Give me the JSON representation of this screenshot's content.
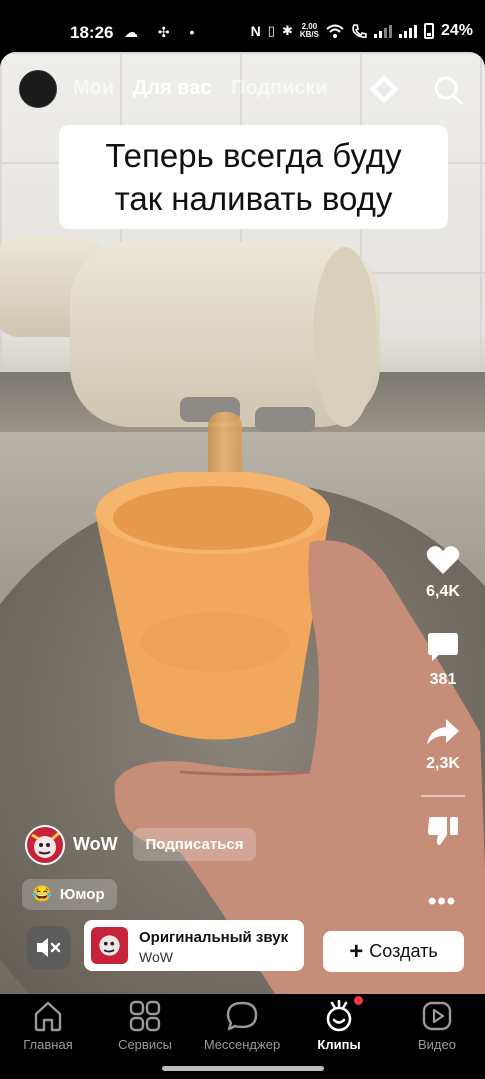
{
  "status_bar": {
    "time": "18:26",
    "speed_value": "2,00",
    "speed_unit": "KB/S",
    "battery": "24%",
    "left_icons": "☁ ✣ •"
  },
  "top_nav": {
    "tabs": [
      {
        "label": "Мои",
        "active": false
      },
      {
        "label": "Для вас",
        "active": true
      },
      {
        "label": "Подписки",
        "active": false
      }
    ]
  },
  "video": {
    "caption_line1": "Теперь всегда буду",
    "caption_line2": "так наливать воду"
  },
  "actions": {
    "likes": "6,4K",
    "comments": "381",
    "shares": "2,3K",
    "more": "•••"
  },
  "author": {
    "name": "WoW",
    "subscribe_label": "Подписаться"
  },
  "tag": {
    "emoji": "😂",
    "label": "Юмор"
  },
  "sound": {
    "title": "Оригинальный звук",
    "author": "WoW"
  },
  "create": {
    "plus": "+",
    "label": "Создать"
  },
  "bottom_nav": {
    "items": [
      {
        "label": "Главная",
        "icon": "home-icon",
        "active": false
      },
      {
        "label": "Сервисы",
        "icon": "services-grid-icon",
        "active": false
      },
      {
        "label": "Мессенджер",
        "icon": "chat-bubble-icon",
        "active": false
      },
      {
        "label": "Клипы",
        "icon": "clips-icon",
        "active": true
      },
      {
        "label": "Видео",
        "icon": "video-icon",
        "active": false
      }
    ]
  },
  "colors": {
    "accent_notification": "#ff3347",
    "background": "#000000",
    "caption_bg": "#ffffff"
  }
}
